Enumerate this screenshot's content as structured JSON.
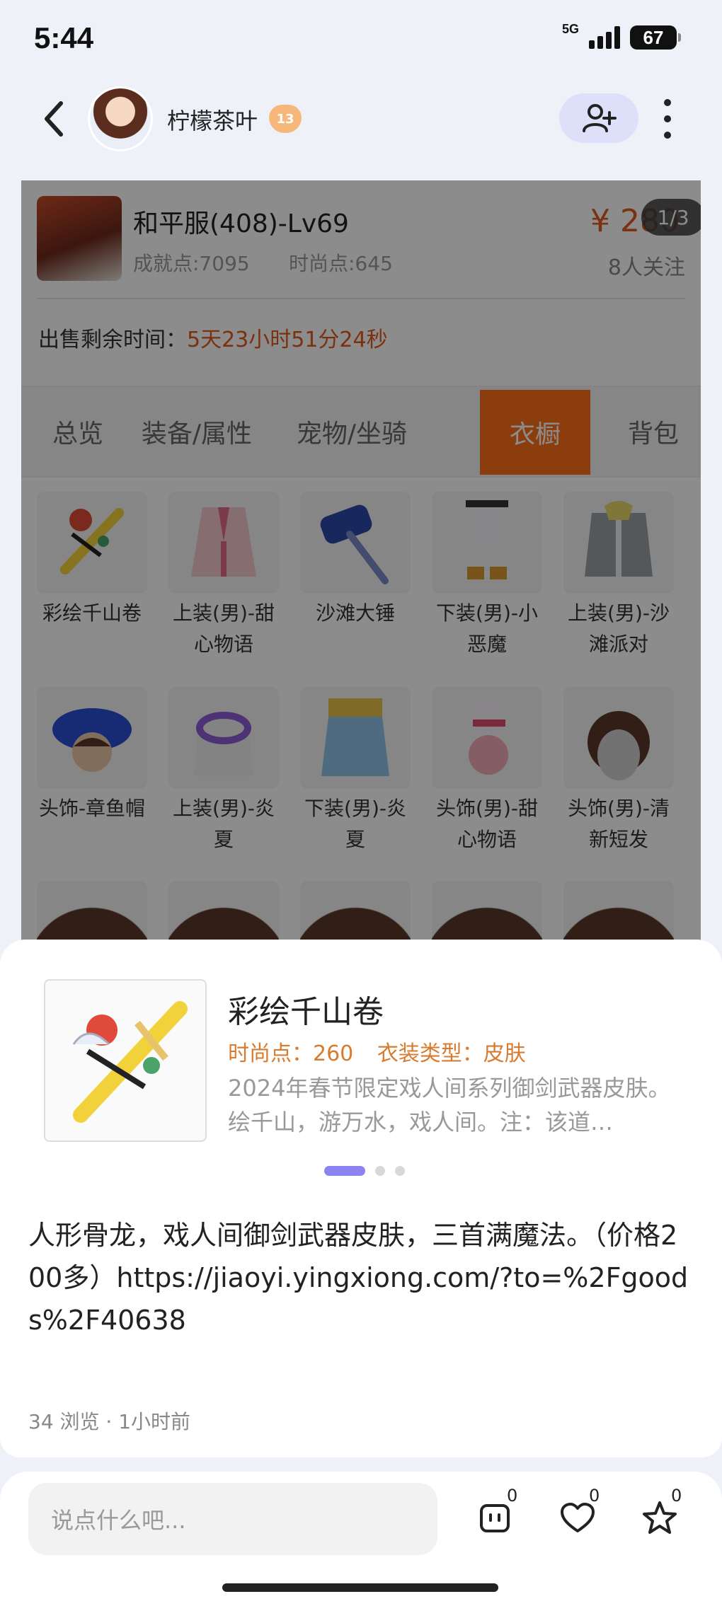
{
  "status_bar": {
    "time": "5:44",
    "network": "5G",
    "battery": "67"
  },
  "chat_header": {
    "user_name": "柠檬茶叶",
    "level": "13"
  },
  "card": {
    "role_name": "和平服(408)-Lv69",
    "achievement": "成就点:7095",
    "fashion": "时尚点:645",
    "price": "¥ 280",
    "followers": "8人关注",
    "page_indicator": "1/3",
    "sale_time_label": "出售剩余时间：",
    "sale_time_value": "5天23小时51分24秒",
    "tabs": [
      {
        "label": "总览",
        "active": false
      },
      {
        "label": "装备/属性",
        "active": false
      },
      {
        "label": "宠物/坐骑",
        "active": false
      },
      {
        "label": "衣橱",
        "active": true
      },
      {
        "label": "背包",
        "active": false
      }
    ],
    "wardrobe_items": [
      {
        "name": "彩绘千山卷",
        "icon": "brush-weapon-icon"
      },
      {
        "name": "上装(男)-甜心物语",
        "icon": "pink-coat-icon"
      },
      {
        "name": "沙滩大锤",
        "icon": "hammer-icon"
      },
      {
        "name": "下装(男)-小恶魔",
        "icon": "pants-icon"
      },
      {
        "name": "上装(男)-沙滩派对",
        "icon": "hoodie-icon"
      },
      {
        "name": "头饰-章鱼帽",
        "icon": "octopus-hat-icon"
      },
      {
        "name": "上装(男)-炎夏",
        "icon": "flower-lei-icon"
      },
      {
        "name": "下装(男)-炎夏",
        "icon": "skirt-icon"
      },
      {
        "name": "头饰(男)-甜心物语",
        "icon": "top-hat-icon"
      },
      {
        "name": "头饰(男)-清新短发",
        "icon": "short-hair-icon"
      }
    ]
  },
  "item_preview": {
    "title": "彩绘千山卷",
    "fashion_points": "时尚点：260",
    "type": "衣装类型：皮肤",
    "description": "2024年春节限定戏人间系列御剑武器皮肤。绘千山，游万水，戏人间。注：该道…"
  },
  "post": {
    "text": "人形骨龙，戏人间御剑武器皮肤，三首满魔法。（价格200多）https://jiaoyi.yingxiong.com/?to=%2Fgoods%2F40638",
    "meta": "34 浏览 · 1小时前"
  },
  "comment_bar": {
    "placeholder": "说点什么吧...",
    "comments": "0",
    "likes": "0",
    "favorites": "0"
  },
  "colors": {
    "accent": "#8b83f0",
    "orange": "#e0581b",
    "tab_active": "#ff6f1a"
  }
}
